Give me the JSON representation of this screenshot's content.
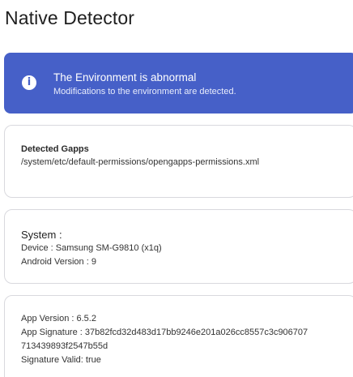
{
  "app": {
    "title": "Native Detector"
  },
  "status": {
    "icon": "info-icon",
    "title": "The Environment is abnormal",
    "subtitle": "Modifications to the environment are detected.",
    "color": "#4660c8"
  },
  "gapps": {
    "title": "Detected Gapps",
    "path": "/system/etc/default-permissions/opengapps-permissions.xml"
  },
  "system": {
    "heading": "System :",
    "device": "Device : Samsung SM-G9810  (x1q)",
    "android_version": "Android Version : 9"
  },
  "app_info": {
    "version": "App Version : 6.5.2",
    "signature_line1": "App Signature : 37b82fcd32d483d17bb9246e201a026cc8557c3c906707",
    "signature_line2": "713439893f2547b55d",
    "signature_valid": "Signature Valid: true"
  }
}
